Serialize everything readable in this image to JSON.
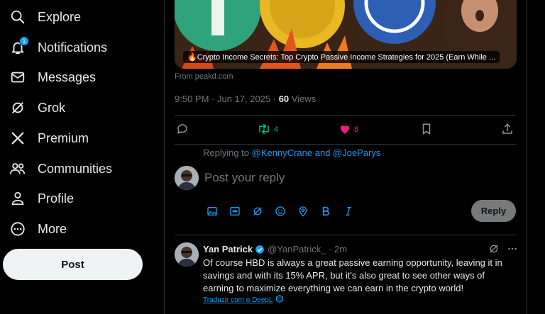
{
  "nav": [
    {
      "label": "Explore",
      "icon": "search-icon"
    },
    {
      "label": "Notifications",
      "icon": "bell-icon",
      "badge": "1"
    },
    {
      "label": "Messages",
      "icon": "mail-icon"
    },
    {
      "label": "Grok",
      "icon": "grok-icon"
    },
    {
      "label": "Premium",
      "icon": "x-logo-icon"
    },
    {
      "label": "Communities",
      "icon": "communities-icon"
    },
    {
      "label": "Profile",
      "icon": "person-icon"
    },
    {
      "label": "More",
      "icon": "more-circle-icon"
    }
  ],
  "post_button": "Post",
  "tweet": {
    "media_caption": "🔥Crypto Income Secrets: Top Crypto Passive Income Strategies for 2025 (Earn While ...",
    "source": "From peakd.com",
    "time": "9:50 PM · Jun 17, 2025 · ",
    "views_count": "60",
    "views_label": " Views",
    "retweets": "4",
    "likes": "8"
  },
  "reply": {
    "replying_prefix": "Replying to ",
    "replying_to": "@KennyCrane and @JoeParys",
    "placeholder": "Post your reply",
    "button": "Reply"
  },
  "reply_tweet": {
    "name": "Yan Patrick",
    "handle": "@YanPatrick_ · 2m",
    "text": "Of course HBD is always a great passive earning opportunity, leaving it in savings and with its 15% APR, but it's also great to see other ways of earning to maximize everything we can earn in the crypto world!",
    "translate": "Traduzir com o DeepL"
  },
  "colors": {
    "accent": "#1d9bf0",
    "retweet": "#00ba7c",
    "like": "#f91880",
    "background": "#000000"
  }
}
